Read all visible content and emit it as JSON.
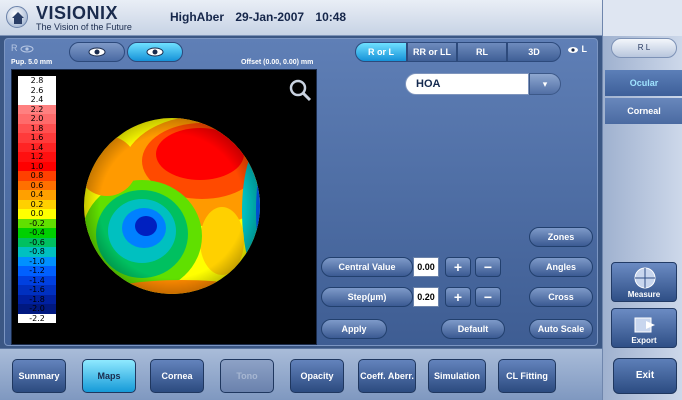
{
  "header": {
    "brand": "VISIONIX",
    "tagline": "The Vision of the Future",
    "patient": "HighAber",
    "date": "29-Jan-2007",
    "time": "10:48"
  },
  "main": {
    "rl_indicator": "R",
    "pupil": "Pup. 5.0 mm",
    "offset": "Offset (0.00, 0.00) mm",
    "view_segments": [
      "R or L",
      "RR or LL",
      "RL",
      "3D"
    ],
    "eye_side": "L",
    "map_select": "HOA",
    "scale": [
      {
        "label": "2.8",
        "color": "#ffffff"
      },
      {
        "label": "2.6",
        "color": "#ffffff"
      },
      {
        "label": "2.4",
        "color": "#ffffff"
      },
      {
        "label": "2.2",
        "color": "#ff8080"
      },
      {
        "label": "2.0",
        "color": "#ff6b6b"
      },
      {
        "label": "1.8",
        "color": "#ff5050"
      },
      {
        "label": "1.6",
        "color": "#ff3b3b"
      },
      {
        "label": "1.4",
        "color": "#ff2424"
      },
      {
        "label": "1.2",
        "color": "#ff1010"
      },
      {
        "label": "1.0",
        "color": "#ff0000"
      },
      {
        "label": "0.8",
        "color": "#ff4000"
      },
      {
        "label": "0.6",
        "color": "#ff7000"
      },
      {
        "label": "0.4",
        "color": "#ffa000"
      },
      {
        "label": "0.2",
        "color": "#ffd000"
      },
      {
        "label": "0.0",
        "color": "#ffff00"
      },
      {
        "label": "-0.2",
        "color": "#60e000"
      },
      {
        "label": "-0.4",
        "color": "#00d000"
      },
      {
        "label": "-0.6",
        "color": "#00c060"
      },
      {
        "label": "-0.8",
        "color": "#00c0c0"
      },
      {
        "label": "-1.0",
        "color": "#0090ff"
      },
      {
        "label": "-1.2",
        "color": "#0060ff"
      },
      {
        "label": "-1.4",
        "color": "#0040e0"
      },
      {
        "label": "-1.6",
        "color": "#0030c0"
      },
      {
        "label": "-1.8",
        "color": "#0020a0"
      },
      {
        "label": "-2.0",
        "color": "#001880"
      },
      {
        "label": "-2.2",
        "color": "#ffffff"
      }
    ],
    "controls": {
      "central_value_label": "Central Value",
      "central_value": "0.00",
      "step_label": "Step(µm)",
      "step_value": "0.20",
      "apply": "Apply",
      "default": "Default",
      "zones": "Zones",
      "angles": "Angles",
      "cross": "Cross",
      "auto_scale": "Auto Scale"
    }
  },
  "right_panel": {
    "toggle": "R L",
    "tab_ocular": "Ocular",
    "tab_corneal": "Corneal",
    "measure": "Measure",
    "export": "Export",
    "exit": "Exit"
  },
  "nav": [
    "Summary",
    "Maps",
    "Cornea",
    "Tono",
    "Opacity",
    "Coeff. Aberr.",
    "Simulation",
    "CL Fitting"
  ]
}
